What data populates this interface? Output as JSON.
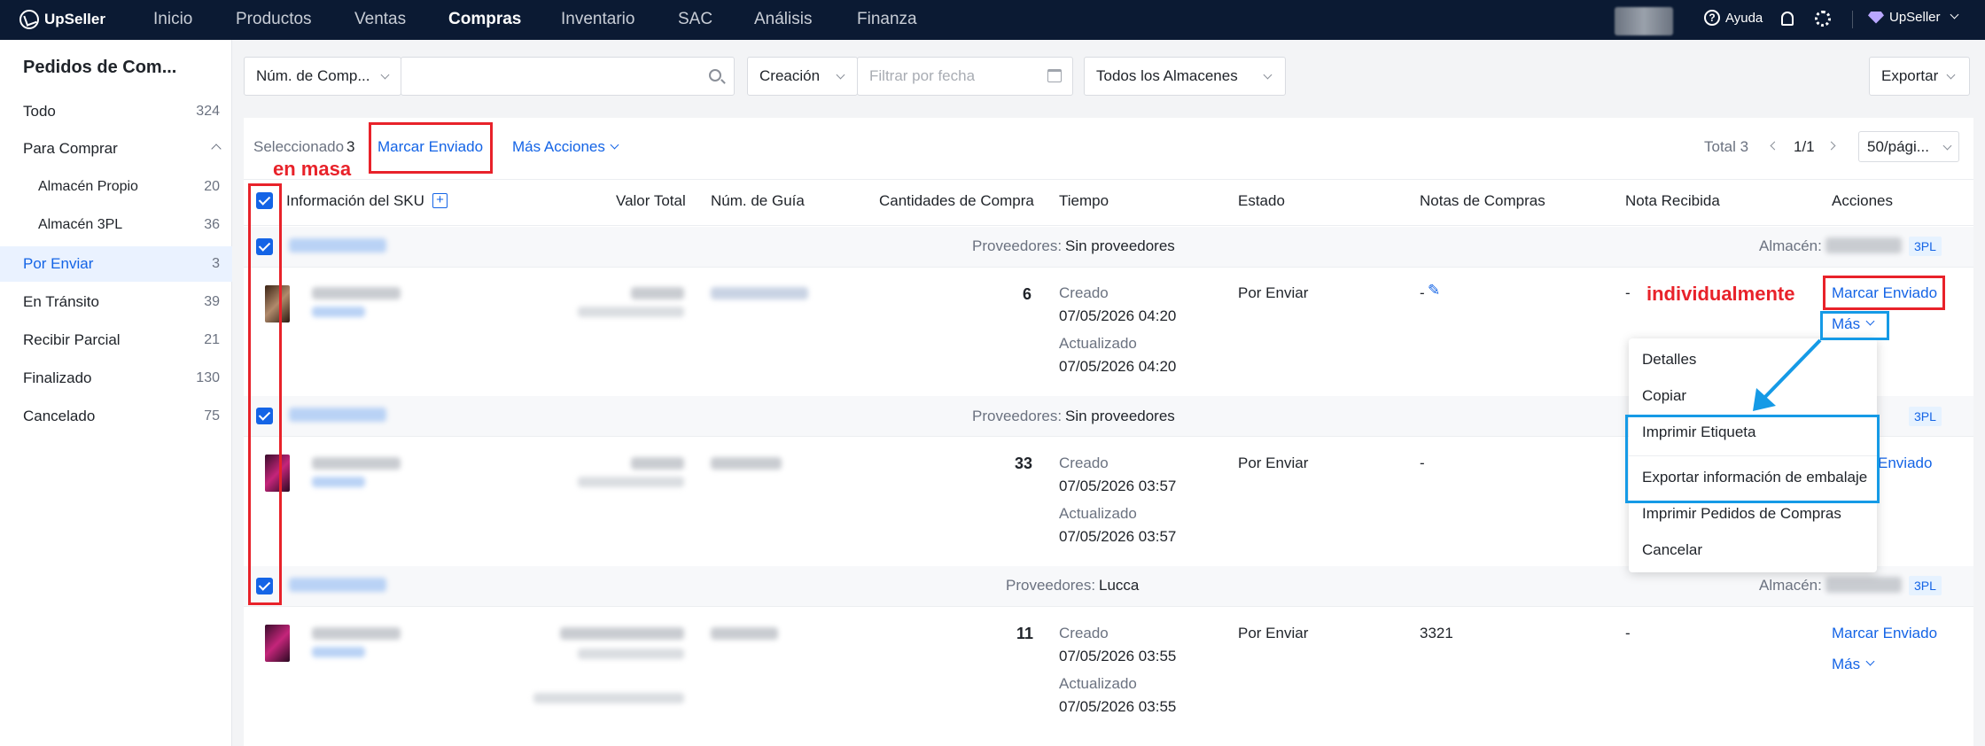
{
  "topbar": {
    "brand": "UpSeller",
    "nav": [
      "Inicio",
      "Productos",
      "Ventas",
      "Compras",
      "Inventario",
      "SAC",
      "Análisis",
      "Finanza"
    ],
    "active_nav": "Compras",
    "help": "Ayuda",
    "account": "UpSeller"
  },
  "sidebar": {
    "title": "Pedidos de Com...",
    "items": [
      {
        "label": "Todo",
        "count": "324"
      },
      {
        "label": "Para Comprar",
        "count": ""
      },
      {
        "label": "Almacén Propio",
        "count": "20"
      },
      {
        "label": "Almacén 3PL",
        "count": "36"
      },
      {
        "label": "Por Enviar",
        "count": "3"
      },
      {
        "label": "En Tránsito",
        "count": "39"
      },
      {
        "label": "Recibir Parcial",
        "count": "21"
      },
      {
        "label": "Finalizado",
        "count": "130"
      },
      {
        "label": "Cancelado",
        "count": "75"
      }
    ]
  },
  "filters": {
    "search_type": "Núm. de Comp...",
    "search_value": "",
    "date_type": "Creación",
    "date_placeholder": "Filtrar por fecha",
    "warehouse": "Todos los Almacenes",
    "export": "Exportar"
  },
  "toolbar": {
    "selected_label": "Seleccionado",
    "selected_count": "3",
    "mark_sent": "Marcar Enviado",
    "more_actions": "Más Acciones",
    "total": "Total 3",
    "page": "1/1",
    "per_page": "50/pági..."
  },
  "table": {
    "headers": [
      "Información del SKU",
      "Valor Total",
      "Núm. de Guía",
      "Cantidades de Compra",
      "Tiempo",
      "Estado",
      "Notas de Compras",
      "Nota Recibida",
      "Acciones"
    ],
    "supplier_label": "Proveedores:",
    "warehouse_label": "Almacén:",
    "tag": "3PL",
    "created_label": "Creado",
    "updated_label": "Actualizado",
    "action_mark": "Marcar Enviado",
    "action_more": "Más",
    "rows": [
      {
        "supplier": "Sin proveedores",
        "qty": "6",
        "created": "07/05/2026 04:20",
        "updated": "07/05/2026 04:20",
        "status": "Por Enviar",
        "notes": "-",
        "received": "-"
      },
      {
        "supplier": "Sin proveedores",
        "qty": "33",
        "created": "07/05/2026 03:57",
        "updated": "07/05/2026 03:57",
        "status": "Por Enviar",
        "notes": "-",
        "received": ""
      },
      {
        "supplier": "Lucca",
        "qty": "11",
        "created": "07/05/2026 03:55",
        "updated": "07/05/2026 03:55",
        "status": "Por Enviar",
        "notes": "3321",
        "received": "-"
      }
    ]
  },
  "dropdown": {
    "items": [
      "Detalles",
      "Copiar",
      "Imprimir Etiqueta",
      "Exportar información de embalaje",
      "Imprimir Pedidos de Compras",
      "Cancelar"
    ]
  },
  "annotations": {
    "bulk": "en masa",
    "individual": "individualmente"
  },
  "colors": {
    "topbar": "#0b1a33",
    "accent": "#1464e6",
    "annotation_red": "#e8222a",
    "annotation_blue": "#159ae6"
  }
}
